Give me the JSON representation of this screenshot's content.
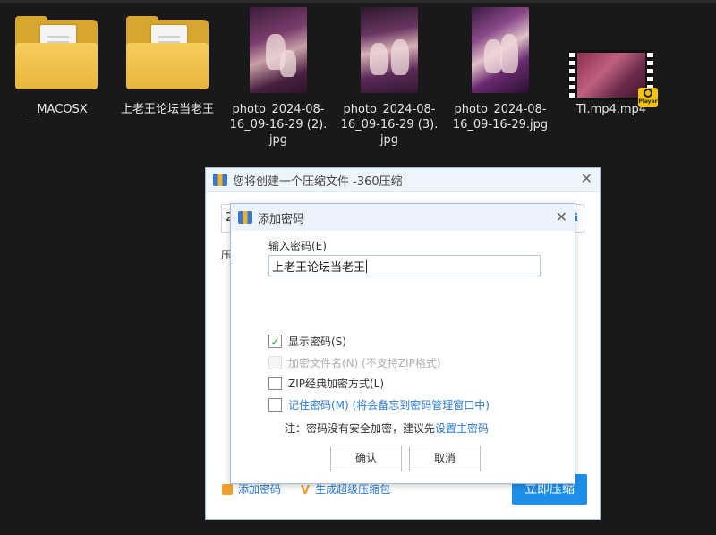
{
  "desktop": {
    "files": [
      {
        "name": "__MACOSX",
        "type": "folder"
      },
      {
        "name": "上老王论坛当老王",
        "type": "folder"
      },
      {
        "name": "photo_2024-08-16_09-16-29 (2).jpg",
        "type": "image"
      },
      {
        "name": "photo_2024-08-16_09-16-29 (3).jpg",
        "type": "image"
      },
      {
        "name": "photo_2024-08-16_09-16-29.jpg",
        "type": "image"
      },
      {
        "name": "Tl.mp4.mp4",
        "type": "video",
        "badge": "Player"
      }
    ]
  },
  "main_dialog": {
    "title": "您将创建一个压缩文件 -360压缩",
    "partial_field_text": "2",
    "partial_label": "压",
    "add_password_link": "添加密码",
    "create_sfx_link": "生成超级压缩包",
    "start_button": "立即压缩"
  },
  "password_dialog": {
    "title": "添加密码",
    "field_label": "输入密码(E)",
    "password_value": "上老王论坛当老王",
    "options": [
      {
        "label": "显示密码(S)",
        "checked": true,
        "enabled": true
      },
      {
        "label": "加密文件名(N) (不支持ZIP格式)",
        "checked": false,
        "enabled": false
      },
      {
        "label": "ZIP经典加密方式(L)",
        "checked": false,
        "enabled": true
      },
      {
        "label": "记住密码(M) (将会备忘到密码管理窗口中)",
        "checked": false,
        "enabled": true
      }
    ],
    "note_text": "注：密码没有安全加密，建议先",
    "note_link": "设置主密码",
    "ok_button": "确认",
    "cancel_button": "取消"
  },
  "colors": {
    "desktop_bg": "#191919",
    "accent_blue": "#1e8ee8",
    "link_blue": "#2a7bd0",
    "check_green": "#2a9a3a",
    "folder_yellow": "#f6cd5d"
  }
}
